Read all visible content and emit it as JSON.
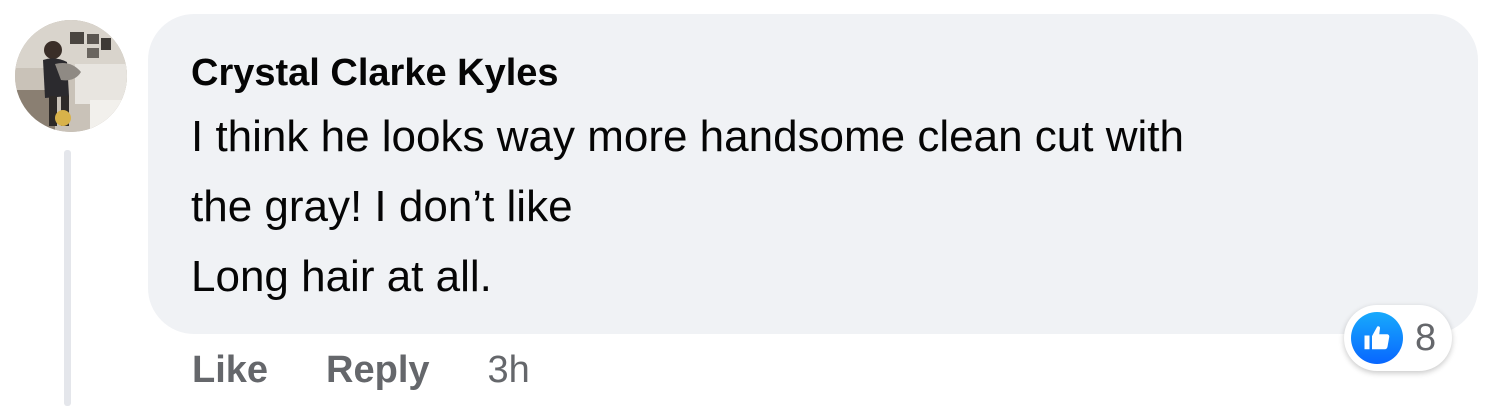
{
  "comment": {
    "author": "Crystal Clarke Kyles",
    "text": "I think he looks way more handsome clean cut with\nthe gray! I don’t like\nLong hair at all."
  },
  "actions": {
    "like_label": "Like",
    "reply_label": "Reply",
    "timestamp": "3h"
  },
  "reactions": {
    "icon": "thumbs-up-icon",
    "count": "8"
  },
  "colors": {
    "bubble": "#f0f2f5",
    "text": "#050505",
    "secondary_text": "#65676b",
    "like_blue": "#0866ff"
  }
}
